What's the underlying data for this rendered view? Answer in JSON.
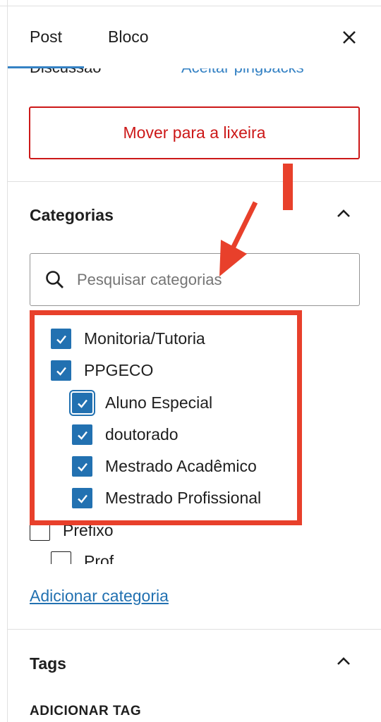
{
  "tabs": {
    "post": "Post",
    "bloco": "Bloco",
    "close_icon": "close-icon"
  },
  "cutoff": {
    "left_text": "Discussão",
    "right_text": "Aceitar pingbacks"
  },
  "trash_button": "Mover para a lixeira",
  "categories": {
    "title": "Categorias",
    "search_placeholder": "Pesquisar categorias",
    "items": [
      {
        "label": "Monitoria/Tutoria",
        "checked": true
      },
      {
        "label": "PPGECO",
        "checked": true
      },
      {
        "label": "Aluno Especial",
        "checked": true
      },
      {
        "label": "doutorado",
        "checked": true
      },
      {
        "label": "Mestrado Acadêmico",
        "checked": true
      },
      {
        "label": "Mestrado Profissional",
        "checked": true
      },
      {
        "label": "Prefixo",
        "checked": false
      },
      {
        "label": "Prof",
        "checked": false
      }
    ],
    "add_link": "Adicionar categoria"
  },
  "tags": {
    "title": "Tags",
    "add_label": "ADICIONAR TAG"
  },
  "colors": {
    "accent": "#2271b1",
    "danger": "#cc1818",
    "annotation": "#e8402b"
  }
}
